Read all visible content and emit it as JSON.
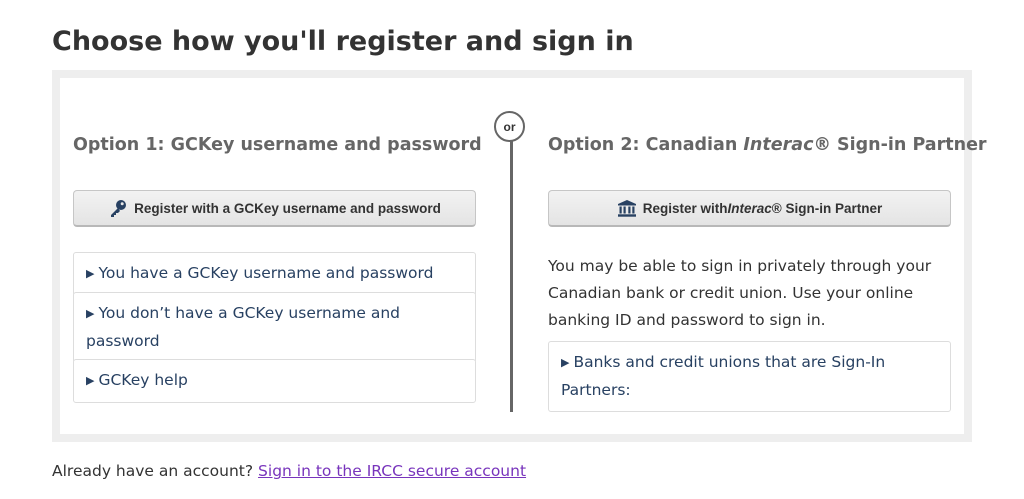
{
  "page": {
    "title": "Choose how you'll register and sign in"
  },
  "divider": {
    "label": "or"
  },
  "option1": {
    "heading": "Option 1: GCKey username and password",
    "button_label": "Register with a GCKey username and password",
    "button_icon": "key-icon",
    "details": [
      {
        "label": "You have a GCKey username and password"
      },
      {
        "label": "You don’t have a GCKey username and password"
      },
      {
        "label": "GCKey help"
      }
    ]
  },
  "option2": {
    "heading_prefix": "Option 2: Canadian ",
    "heading_brand": "Interac",
    "heading_suffix": "® Sign-in Partner",
    "button_prefix": "Register with ",
    "button_brand": "Interac",
    "button_suffix": "® Sign-in Partner",
    "button_icon": "bank-icon",
    "description": "You may be able to sign in privately through your Canadian bank or credit union. Use your online banking ID and password to sign in.",
    "details": [
      {
        "label": "Banks and credit unions that are Sign-In Partners:"
      }
    ]
  },
  "footer": {
    "prompt": "Already have an account?",
    "link_label": "Sign in to the IRCC secure account"
  },
  "colors": {
    "link": "#284162",
    "visited_link": "#7834bc",
    "heading_gray": "#666666",
    "panel_background": "#eeeeee"
  }
}
